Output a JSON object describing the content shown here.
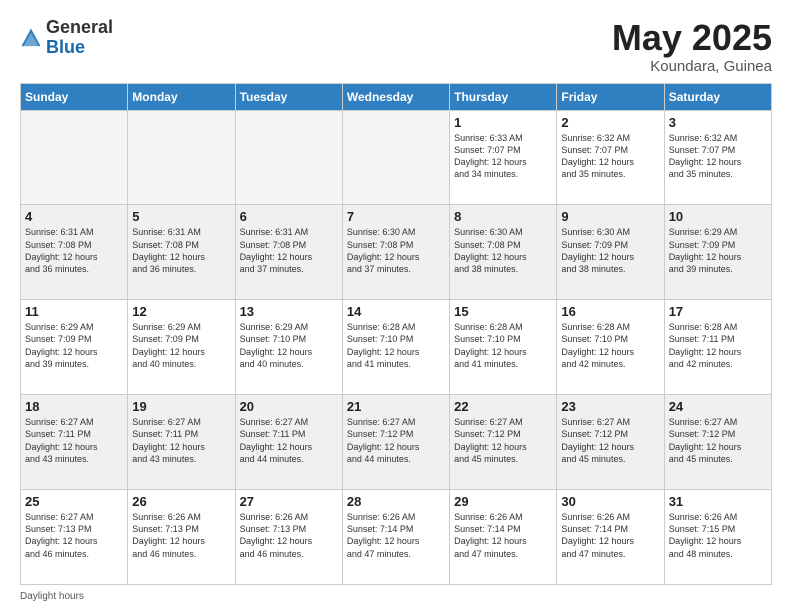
{
  "logo": {
    "general": "General",
    "blue": "Blue"
  },
  "title": {
    "month": "May 2025",
    "location": "Koundara, Guinea"
  },
  "days_of_week": [
    "Sunday",
    "Monday",
    "Tuesday",
    "Wednesday",
    "Thursday",
    "Friday",
    "Saturday"
  ],
  "weeks": [
    [
      {
        "day": "",
        "info": "",
        "empty": true
      },
      {
        "day": "",
        "info": "",
        "empty": true
      },
      {
        "day": "",
        "info": "",
        "empty": true
      },
      {
        "day": "",
        "info": "",
        "empty": true
      },
      {
        "day": "1",
        "info": "Sunrise: 6:33 AM\nSunset: 7:07 PM\nDaylight: 12 hours\nand 34 minutes.",
        "empty": false
      },
      {
        "day": "2",
        "info": "Sunrise: 6:32 AM\nSunset: 7:07 PM\nDaylight: 12 hours\nand 35 minutes.",
        "empty": false
      },
      {
        "day": "3",
        "info": "Sunrise: 6:32 AM\nSunset: 7:07 PM\nDaylight: 12 hours\nand 35 minutes.",
        "empty": false
      }
    ],
    [
      {
        "day": "4",
        "info": "Sunrise: 6:31 AM\nSunset: 7:08 PM\nDaylight: 12 hours\nand 36 minutes.",
        "empty": false
      },
      {
        "day": "5",
        "info": "Sunrise: 6:31 AM\nSunset: 7:08 PM\nDaylight: 12 hours\nand 36 minutes.",
        "empty": false
      },
      {
        "day": "6",
        "info": "Sunrise: 6:31 AM\nSunset: 7:08 PM\nDaylight: 12 hours\nand 37 minutes.",
        "empty": false
      },
      {
        "day": "7",
        "info": "Sunrise: 6:30 AM\nSunset: 7:08 PM\nDaylight: 12 hours\nand 37 minutes.",
        "empty": false
      },
      {
        "day": "8",
        "info": "Sunrise: 6:30 AM\nSunset: 7:08 PM\nDaylight: 12 hours\nand 38 minutes.",
        "empty": false
      },
      {
        "day": "9",
        "info": "Sunrise: 6:30 AM\nSunset: 7:09 PM\nDaylight: 12 hours\nand 38 minutes.",
        "empty": false
      },
      {
        "day": "10",
        "info": "Sunrise: 6:29 AM\nSunset: 7:09 PM\nDaylight: 12 hours\nand 39 minutes.",
        "empty": false
      }
    ],
    [
      {
        "day": "11",
        "info": "Sunrise: 6:29 AM\nSunset: 7:09 PM\nDaylight: 12 hours\nand 39 minutes.",
        "empty": false
      },
      {
        "day": "12",
        "info": "Sunrise: 6:29 AM\nSunset: 7:09 PM\nDaylight: 12 hours\nand 40 minutes.",
        "empty": false
      },
      {
        "day": "13",
        "info": "Sunrise: 6:29 AM\nSunset: 7:10 PM\nDaylight: 12 hours\nand 40 minutes.",
        "empty": false
      },
      {
        "day": "14",
        "info": "Sunrise: 6:28 AM\nSunset: 7:10 PM\nDaylight: 12 hours\nand 41 minutes.",
        "empty": false
      },
      {
        "day": "15",
        "info": "Sunrise: 6:28 AM\nSunset: 7:10 PM\nDaylight: 12 hours\nand 41 minutes.",
        "empty": false
      },
      {
        "day": "16",
        "info": "Sunrise: 6:28 AM\nSunset: 7:10 PM\nDaylight: 12 hours\nand 42 minutes.",
        "empty": false
      },
      {
        "day": "17",
        "info": "Sunrise: 6:28 AM\nSunset: 7:11 PM\nDaylight: 12 hours\nand 42 minutes.",
        "empty": false
      }
    ],
    [
      {
        "day": "18",
        "info": "Sunrise: 6:27 AM\nSunset: 7:11 PM\nDaylight: 12 hours\nand 43 minutes.",
        "empty": false
      },
      {
        "day": "19",
        "info": "Sunrise: 6:27 AM\nSunset: 7:11 PM\nDaylight: 12 hours\nand 43 minutes.",
        "empty": false
      },
      {
        "day": "20",
        "info": "Sunrise: 6:27 AM\nSunset: 7:11 PM\nDaylight: 12 hours\nand 44 minutes.",
        "empty": false
      },
      {
        "day": "21",
        "info": "Sunrise: 6:27 AM\nSunset: 7:12 PM\nDaylight: 12 hours\nand 44 minutes.",
        "empty": false
      },
      {
        "day": "22",
        "info": "Sunrise: 6:27 AM\nSunset: 7:12 PM\nDaylight: 12 hours\nand 45 minutes.",
        "empty": false
      },
      {
        "day": "23",
        "info": "Sunrise: 6:27 AM\nSunset: 7:12 PM\nDaylight: 12 hours\nand 45 minutes.",
        "empty": false
      },
      {
        "day": "24",
        "info": "Sunrise: 6:27 AM\nSunset: 7:12 PM\nDaylight: 12 hours\nand 45 minutes.",
        "empty": false
      }
    ],
    [
      {
        "day": "25",
        "info": "Sunrise: 6:27 AM\nSunset: 7:13 PM\nDaylight: 12 hours\nand 46 minutes.",
        "empty": false
      },
      {
        "day": "26",
        "info": "Sunrise: 6:26 AM\nSunset: 7:13 PM\nDaylight: 12 hours\nand 46 minutes.",
        "empty": false
      },
      {
        "day": "27",
        "info": "Sunrise: 6:26 AM\nSunset: 7:13 PM\nDaylight: 12 hours\nand 46 minutes.",
        "empty": false
      },
      {
        "day": "28",
        "info": "Sunrise: 6:26 AM\nSunset: 7:14 PM\nDaylight: 12 hours\nand 47 minutes.",
        "empty": false
      },
      {
        "day": "29",
        "info": "Sunrise: 6:26 AM\nSunset: 7:14 PM\nDaylight: 12 hours\nand 47 minutes.",
        "empty": false
      },
      {
        "day": "30",
        "info": "Sunrise: 6:26 AM\nSunset: 7:14 PM\nDaylight: 12 hours\nand 47 minutes.",
        "empty": false
      },
      {
        "day": "31",
        "info": "Sunrise: 6:26 AM\nSunset: 7:15 PM\nDaylight: 12 hours\nand 48 minutes.",
        "empty": false
      }
    ]
  ],
  "footer": {
    "daylight_label": "Daylight hours"
  }
}
